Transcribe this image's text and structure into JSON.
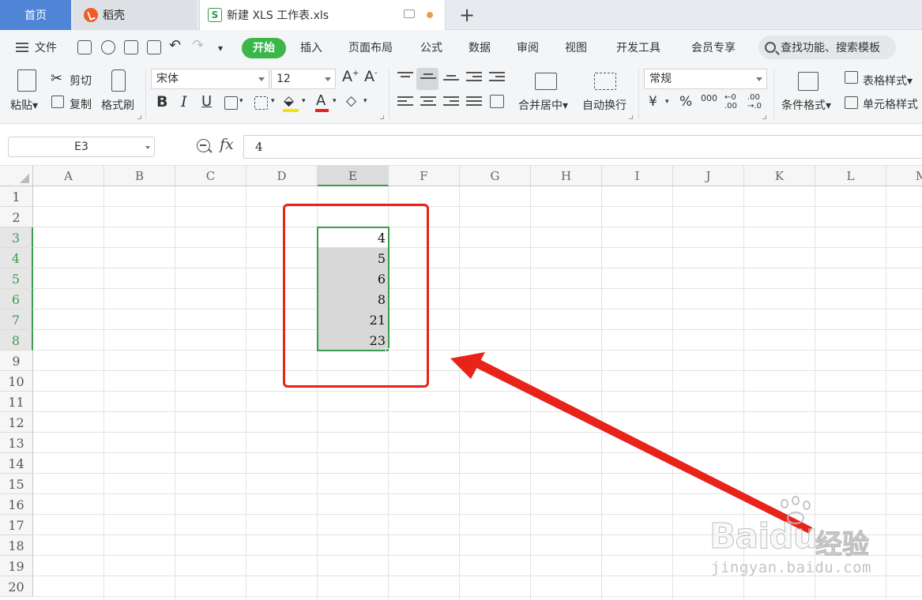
{
  "tabs": {
    "home": "首页",
    "daoke": "稻壳",
    "file": "新建 XLS 工作表.xls",
    "file_icon_letter": "S",
    "add": "+"
  },
  "menu": {
    "file": "文件",
    "start": "开始",
    "items": [
      "插入",
      "页面布局",
      "公式",
      "数据",
      "审阅",
      "视图",
      "开发工具",
      "会员专享"
    ],
    "search_placeholder": "查找功能、搜索模板"
  },
  "toolbar": {
    "paste": "粘贴",
    "cut": "剪切",
    "copy": "复制",
    "format_painter": "格式刷",
    "font_name": "宋体",
    "font_size": "12",
    "bold": "B",
    "italic": "I",
    "underline": "U",
    "merge_center": "合并居中",
    "auto_wrap": "自动换行",
    "number_format": "常规",
    "currency": "¥",
    "percent": "%",
    "thousands": "000",
    "inc_decimal": ".00",
    "dec_decimal": ".0",
    "conditional_format": "条件格式",
    "table_style": "表格样式",
    "cell_style": "单元格样式"
  },
  "formula_bar": {
    "cell_ref": "E3",
    "fx": "fx",
    "value": "4"
  },
  "sheet": {
    "columns": [
      "A",
      "B",
      "C",
      "D",
      "E",
      "F",
      "G",
      "H",
      "I",
      "J",
      "K",
      "L",
      "M"
    ],
    "selected_column": "E",
    "rows": [
      "1",
      "2",
      "3",
      "4",
      "5",
      "6",
      "7",
      "8",
      "9",
      "10",
      "11",
      "12",
      "13",
      "14",
      "15",
      "16",
      "17",
      "18",
      "19",
      "20"
    ],
    "selected_rows": [
      "3",
      "4",
      "5",
      "6",
      "7",
      "8"
    ],
    "column_e_values": [
      "4",
      "5",
      "6",
      "8",
      "21",
      "23"
    ]
  },
  "watermark": {
    "brand": "Baidu",
    "cn": "经验",
    "url": "jingyan.baidu.com"
  },
  "colors": {
    "accent_green": "#3cb54a",
    "selection_green": "#3d9b4f",
    "home_tab_blue": "#4f84d6",
    "annotation_red": "#e8231a"
  }
}
